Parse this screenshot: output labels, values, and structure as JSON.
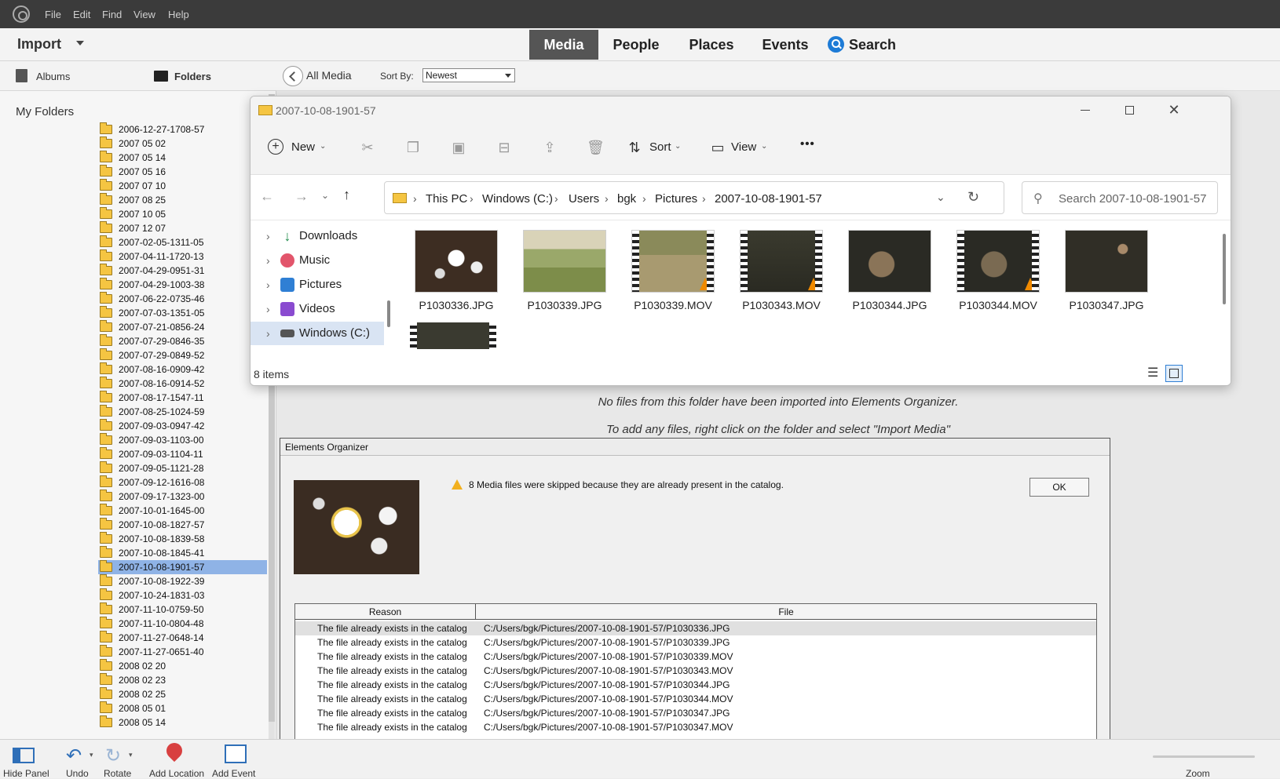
{
  "menubar": {
    "items": [
      "File",
      "Edit",
      "Find",
      "View",
      "Help"
    ]
  },
  "header": {
    "import_label": "Import",
    "tabs": [
      "Media",
      "People",
      "Places",
      "Events"
    ],
    "active_tab": "Media",
    "search_label": "Search"
  },
  "left_tabs": {
    "albums": "Albums",
    "folders": "Folders"
  },
  "my_folders_label": "My Folders",
  "folders": [
    "2006-12-27-1708-57",
    "2007 05 02",
    "2007 05 14",
    "2007 05 16",
    "2007 07 10",
    "2007 08 25",
    "2007 10 05",
    "2007 12 07",
    "2007-02-05-1311-05",
    "2007-04-11-1720-13",
    "2007-04-29-0951-31",
    "2007-04-29-1003-38",
    "2007-06-22-0735-46",
    "2007-07-03-1351-05",
    "2007-07-21-0856-24",
    "2007-07-29-0846-35",
    "2007-07-29-0849-52",
    "2007-08-16-0909-42",
    "2007-08-16-0914-52",
    "2007-08-17-1547-11",
    "2007-08-25-1024-59",
    "2007-09-03-0947-42",
    "2007-09-03-1103-00",
    "2007-09-03-1104-11",
    "2007-09-05-1121-28",
    "2007-09-12-1616-08",
    "2007-09-17-1323-00",
    "2007-10-01-1645-00",
    "2007-10-08-1827-57",
    "2007-10-08-1839-58",
    "2007-10-08-1845-41",
    "2007-10-08-1901-57",
    "2007-10-08-1922-39",
    "2007-10-24-1831-03",
    "2007-11-10-0759-50",
    "2007-11-10-0804-48",
    "2007-11-27-0648-14",
    "2007-11-27-0651-40",
    "2008 02 20",
    "2008 02 23",
    "2008 02 25",
    "2008 05 01",
    "2008 05 14"
  ],
  "selected_folder": "2007-10-08-1901-57",
  "media_toolbar": {
    "all_media": "All Media",
    "sort_by_label": "Sort By:",
    "sort_value": "Newest"
  },
  "info": {
    "line1": "No files from this folder have been imported into Elements Organizer.",
    "line2": "To add any files, right click on the folder and select \"Import Media\""
  },
  "explorer": {
    "title": "2007-10-08-1901-57",
    "cmd": {
      "new": "New",
      "sort": "Sort",
      "view": "View",
      "more": "•••"
    },
    "breadcrumb": [
      "This PC",
      "Windows (C:)",
      "Users",
      "bgk",
      "Pictures",
      "2007-10-08-1901-57"
    ],
    "search_placeholder": "Search 2007-10-08-1901-57",
    "nav": [
      "Downloads",
      "Music",
      "Pictures",
      "Videos",
      "Windows (C:)"
    ],
    "files": [
      "P1030336.JPG",
      "P1030339.JPG",
      "P1030339.MOV",
      "P1030343.MOV",
      "P1030344.JPG",
      "P1030344.MOV",
      "P1030347.JPG"
    ],
    "status": "8 items"
  },
  "dialog": {
    "title": "Elements Organizer",
    "warning": "8 Media files were skipped because they are already present in the catalog.",
    "ok_label": "OK",
    "columns": [
      "Reason",
      "File"
    ],
    "rows": [
      {
        "reason": "The file already exists in the catalog",
        "file": "C:/Users/bgk/Pictures/2007-10-08-1901-57/P1030336.JPG"
      },
      {
        "reason": "The file already exists in the catalog",
        "file": "C:/Users/bgk/Pictures/2007-10-08-1901-57/P1030339.JPG"
      },
      {
        "reason": "The file already exists in the catalog",
        "file": "C:/Users/bgk/Pictures/2007-10-08-1901-57/P1030339.MOV"
      },
      {
        "reason": "The file already exists in the catalog",
        "file": "C:/Users/bgk/Pictures/2007-10-08-1901-57/P1030343.MOV"
      },
      {
        "reason": "The file already exists in the catalog",
        "file": "C:/Users/bgk/Pictures/2007-10-08-1901-57/P1030344.JPG"
      },
      {
        "reason": "The file already exists in the catalog",
        "file": "C:/Users/bgk/Pictures/2007-10-08-1901-57/P1030344.MOV"
      },
      {
        "reason": "The file already exists in the catalog",
        "file": "C:/Users/bgk/Pictures/2007-10-08-1901-57/P1030347.JPG"
      },
      {
        "reason": "The file already exists in the catalog",
        "file": "C:/Users/bgk/Pictures/2007-10-08-1901-57/P1030347.MOV"
      }
    ]
  },
  "bottombar": {
    "hide_panel": "Hide Panel",
    "undo": "Undo",
    "rotate": "Rotate",
    "add_location": "Add Location",
    "add_event": "Add Event",
    "zoom": "Zoom"
  },
  "colors": {
    "accent": "#1d7bd6",
    "selected_folder": "#8fb3e6",
    "active_tab": "#555555",
    "folder": "#f5c542"
  }
}
